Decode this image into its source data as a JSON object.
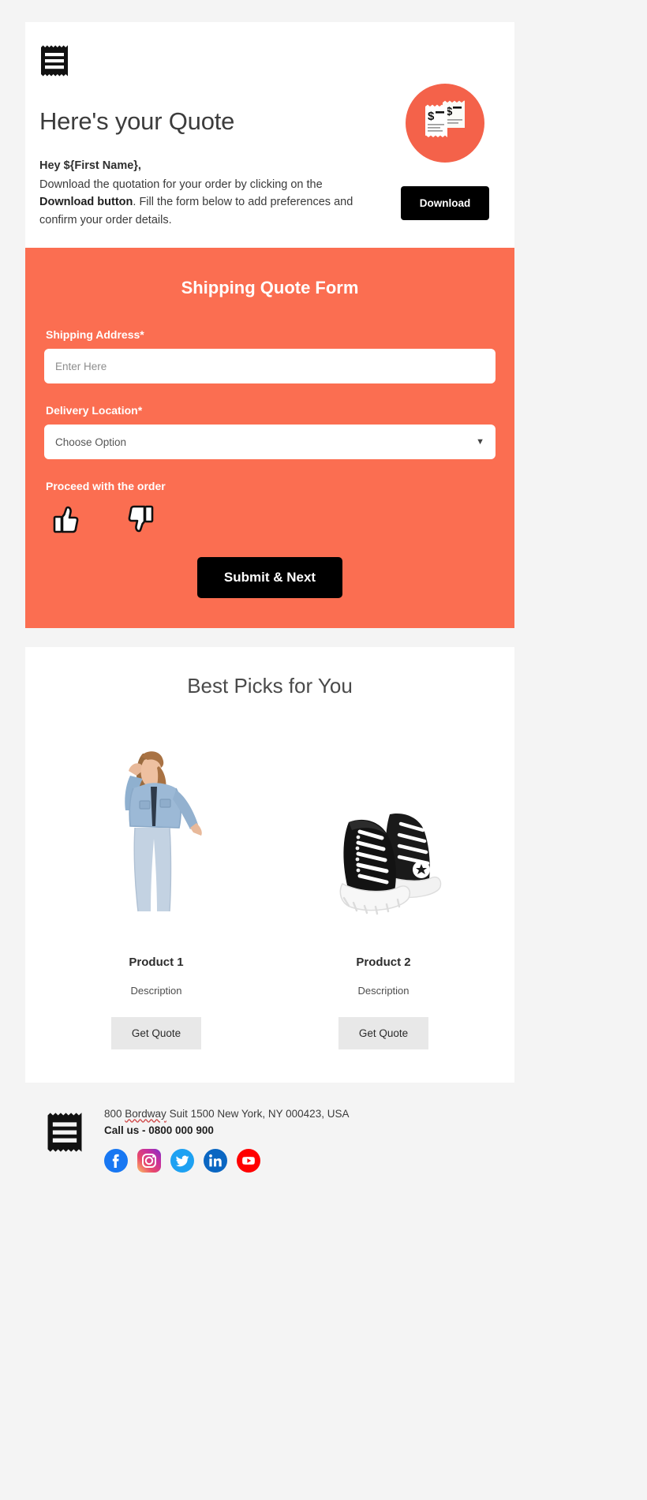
{
  "brand": {
    "accent": "#fb6e51",
    "badge_color": "#f4624a",
    "logo_icon": "receipt-icon"
  },
  "hero": {
    "title": "Here's your Quote",
    "greeting": "Hey ${First Name},",
    "paragraph_part1": "Download the quotation for your order by clicking on the ",
    "paragraph_bold": "Download button",
    "paragraph_part2": ". Fill the form below to add preferences and confirm your order details.",
    "badge_icon": "receipt-dollar-icon",
    "download_label": "Download"
  },
  "form": {
    "title": "Shipping Quote Form",
    "address_label": "Shipping Address*",
    "address_placeholder": "Enter Here",
    "address_value": "",
    "location_label": "Delivery Location*",
    "location_selected": "Choose Option",
    "location_options": [
      "Choose Option"
    ],
    "caret_icon": "chevron-down-icon",
    "proceed_label": "Proceed with the order",
    "thumbs_up_icon": "thumbs-up-icon",
    "thumbs_down_icon": "thumbs-down-icon",
    "submit_label": "Submit & Next"
  },
  "products": {
    "title": "Best Picks for You",
    "items": [
      {
        "name": "Product 1",
        "description": "Description",
        "button_label": "Get Quote",
        "image_alt": "woman-in-denim-jacket-and-jeans"
      },
      {
        "name": "Product 2",
        "description": "Description",
        "button_label": "Get Quote",
        "image_alt": "black-high-top-sneakers"
      }
    ]
  },
  "footer": {
    "logo_icon": "receipt-icon",
    "address_pre": "800 ",
    "address_misspelled": "Bordway",
    "address_post": " Suit 1500 New York, NY 000423, USA",
    "call": "Call us - 0800 000 900",
    "socials": [
      {
        "name": "facebook",
        "color": "#1877f2"
      },
      {
        "name": "instagram",
        "color": "#e1306c"
      },
      {
        "name": "twitter",
        "color": "#1da1f2"
      },
      {
        "name": "linkedin",
        "color": "#0a66c2"
      },
      {
        "name": "youtube",
        "color": "#ff0000"
      }
    ]
  }
}
